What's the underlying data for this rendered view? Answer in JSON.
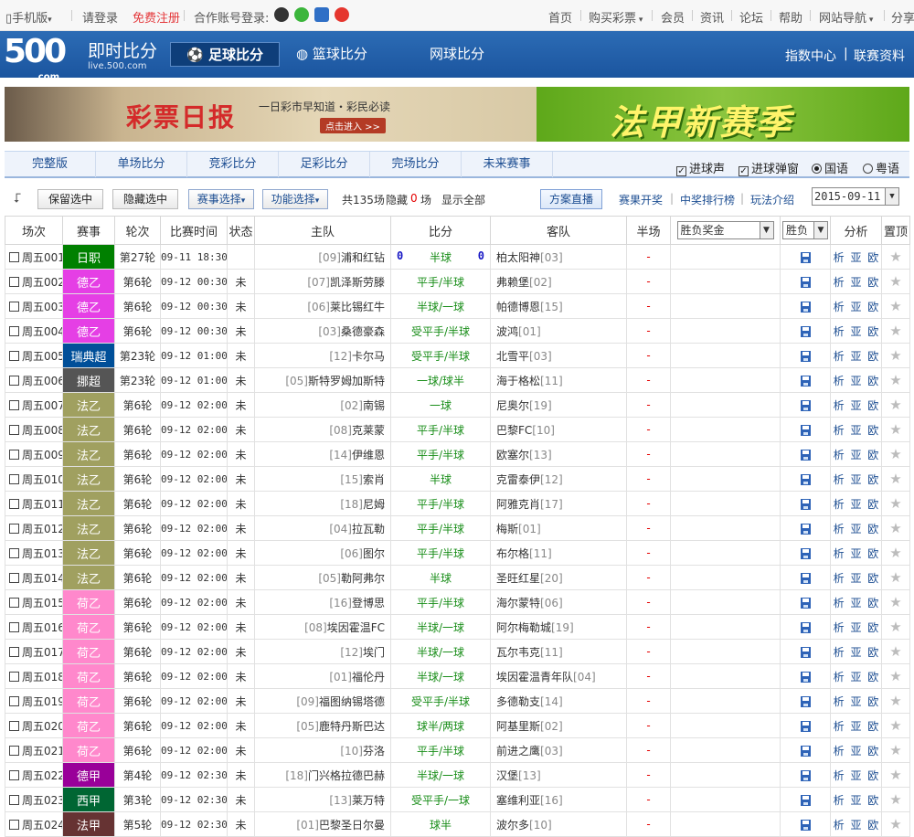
{
  "topbar": {
    "mobile": "手机版",
    "login": "请登录",
    "register": "免费注册",
    "partner_login": "合作账号登录:",
    "nav": [
      "首页",
      "购买彩票",
      "会员",
      "资讯",
      "论坛",
      "帮助",
      "网站导航",
      "分享"
    ]
  },
  "header": {
    "logo": "500",
    "logo_sub": ".com",
    "title": "即时比分",
    "url": "live.500.com",
    "tabs": [
      "足球比分",
      "篮球比分",
      "网球比分"
    ],
    "right_links": [
      "指数中心",
      "联赛资料"
    ],
    "right_sep": "|"
  },
  "banner": {
    "left_title": "彩票日报",
    "left_slogan": "一日彩市早知道・彩民必读",
    "left_button": "点击进入 >>",
    "right_title": "法甲新赛季"
  },
  "category_tabs": [
    "完整版",
    "单场比分",
    "竞彩比分",
    "足彩比分",
    "完场比分",
    "未来赛事"
  ],
  "options": {
    "goal_sound": "进球声",
    "goal_popup": "进球弹窗",
    "mandarin": "国语",
    "cantonese": "粤语"
  },
  "toolbar": {
    "keep_selected": "保留选中",
    "hide_selected": "隐藏选中",
    "event_filter": "赛事选择",
    "function_filter": "功能选择",
    "total_label": "共135场",
    "hidden_label": "隐藏",
    "hidden_count": "0",
    "hidden_unit": "场",
    "show_all": "显示全部",
    "plan_live": "方案直播",
    "result_draw": "赛果开奖",
    "prize_rank": "中奖排行榜",
    "play_intro": "玩法介绍",
    "date": "2015-09-11"
  },
  "table": {
    "headers": [
      "场次",
      "赛事",
      "轮次",
      "比赛时间",
      "状态",
      "主队",
      "比分",
      "客队",
      "半场",
      "胜负奖金",
      "胜负",
      "分析",
      "置顶"
    ],
    "analysis_links": "析 亚 欧",
    "rows": [
      {
        "no": "周五001",
        "league": "日职",
        "color": "#008000",
        "round": "第27轮",
        "time": "09-11 18:30",
        "status": "",
        "home_rank": "[09]",
        "home": "浦和红钻",
        "score": "半球",
        "hs": "0",
        "as": "0",
        "away": "柏太阳神",
        "away_rank": "[03]",
        "half": "-"
      },
      {
        "no": "周五002",
        "league": "德乙",
        "color": "#e53fe5",
        "round": "第6轮",
        "time": "09-12 00:30",
        "status": "未",
        "home_rank": "[07]",
        "home": "凯泽斯劳滕",
        "score": "平手/半球",
        "away": "弗赖堡",
        "away_rank": "[02]",
        "half": "-"
      },
      {
        "no": "周五003",
        "league": "德乙",
        "color": "#e53fe5",
        "round": "第6轮",
        "time": "09-12 00:30",
        "status": "未",
        "home_rank": "[06]",
        "home": "莱比锡红牛",
        "score": "半球/一球",
        "away": "帕德博恩",
        "away_rank": "[15]",
        "half": "-"
      },
      {
        "no": "周五004",
        "league": "德乙",
        "color": "#e53fe5",
        "round": "第6轮",
        "time": "09-12 00:30",
        "status": "未",
        "home_rank": "[03]",
        "home": "桑德豪森",
        "score": "受平手/半球",
        "away": "波鸿",
        "away_rank": "[01]",
        "half": "-"
      },
      {
        "no": "周五005",
        "league": "瑞典超",
        "color": "#004f99",
        "round": "第23轮",
        "time": "09-12 01:00",
        "status": "未",
        "home_rank": "[12]",
        "home": "卡尔马",
        "score": "受平手/半球",
        "away": "北雪平",
        "away_rank": "[03]",
        "half": "-"
      },
      {
        "no": "周五006",
        "league": "挪超",
        "color": "#555555",
        "round": "第23轮",
        "time": "09-12 01:00",
        "status": "未",
        "home_rank": "[05]",
        "home": "斯特罗姆加斯特",
        "score": "一球/球半",
        "away": "海于格松",
        "away_rank": "[11]",
        "half": "-"
      },
      {
        "no": "周五007",
        "league": "法乙",
        "color": "#a0a060",
        "round": "第6轮",
        "time": "09-12 02:00",
        "status": "未",
        "home_rank": "[02]",
        "home": "南锡",
        "score": "一球",
        "away": "尼奥尔",
        "away_rank": "[19]",
        "half": "-"
      },
      {
        "no": "周五008",
        "league": "法乙",
        "color": "#a0a060",
        "round": "第6轮",
        "time": "09-12 02:00",
        "status": "未",
        "home_rank": "[08]",
        "home": "克莱蒙",
        "score": "平手/半球",
        "away": "巴黎FC",
        "away_rank": "[10]",
        "half": "-"
      },
      {
        "no": "周五009",
        "league": "法乙",
        "color": "#a0a060",
        "round": "第6轮",
        "time": "09-12 02:00",
        "status": "未",
        "home_rank": "[14]",
        "home": "伊维恩",
        "score": "平手/半球",
        "away": "欧塞尔",
        "away_rank": "[13]",
        "half": "-"
      },
      {
        "no": "周五010",
        "league": "法乙",
        "color": "#a0a060",
        "round": "第6轮",
        "time": "09-12 02:00",
        "status": "未",
        "home_rank": "[15]",
        "home": "索肖",
        "score": "半球",
        "away": "克雷泰伊",
        "away_rank": "[12]",
        "half": "-"
      },
      {
        "no": "周五011",
        "league": "法乙",
        "color": "#a0a060",
        "round": "第6轮",
        "time": "09-12 02:00",
        "status": "未",
        "home_rank": "[18]",
        "home": "尼姆",
        "score": "平手/半球",
        "away": "阿雅克肖",
        "away_rank": "[17]",
        "half": "-"
      },
      {
        "no": "周五012",
        "league": "法乙",
        "color": "#a0a060",
        "round": "第6轮",
        "time": "09-12 02:00",
        "status": "未",
        "home_rank": "[04]",
        "home": "拉瓦勒",
        "score": "平手/半球",
        "away": "梅斯",
        "away_rank": "[01]",
        "half": "-"
      },
      {
        "no": "周五013",
        "league": "法乙",
        "color": "#a0a060",
        "round": "第6轮",
        "time": "09-12 02:00",
        "status": "未",
        "home_rank": "[06]",
        "home": "图尔",
        "score": "平手/半球",
        "away": "布尔格",
        "away_rank": "[11]",
        "half": "-"
      },
      {
        "no": "周五014",
        "league": "法乙",
        "color": "#a0a060",
        "round": "第6轮",
        "time": "09-12 02:00",
        "status": "未",
        "home_rank": "[05]",
        "home": "勒阿弗尔",
        "score": "半球",
        "away": "圣旺红星",
        "away_rank": "[20]",
        "half": "-"
      },
      {
        "no": "周五015",
        "league": "荷乙",
        "color": "#ff88cc",
        "round": "第6轮",
        "time": "09-12 02:00",
        "status": "未",
        "home_rank": "[16]",
        "home": "登博思",
        "score": "平手/半球",
        "away": "海尔蒙特",
        "away_rank": "[06]",
        "half": "-"
      },
      {
        "no": "周五016",
        "league": "荷乙",
        "color": "#ff88cc",
        "round": "第6轮",
        "time": "09-12 02:00",
        "status": "未",
        "home_rank": "[08]",
        "home": "埃因霍温FC",
        "score": "半球/一球",
        "away": "阿尔梅勒城",
        "away_rank": "[19]",
        "half": "-"
      },
      {
        "no": "周五017",
        "league": "荷乙",
        "color": "#ff88cc",
        "round": "第6轮",
        "time": "09-12 02:00",
        "status": "未",
        "home_rank": "[12]",
        "home": "埃门",
        "score": "半球/一球",
        "away": "瓦尔韦克",
        "away_rank": "[11]",
        "half": "-"
      },
      {
        "no": "周五018",
        "league": "荷乙",
        "color": "#ff88cc",
        "round": "第6轮",
        "time": "09-12 02:00",
        "status": "未",
        "home_rank": "[01]",
        "home": "福伦丹",
        "score": "半球/一球",
        "away": "埃因霍温青年队",
        "away_rank": "[04]",
        "half": "-"
      },
      {
        "no": "周五019",
        "league": "荷乙",
        "color": "#ff88cc",
        "round": "第6轮",
        "time": "09-12 02:00",
        "status": "未",
        "home_rank": "[09]",
        "home": "福图纳锡塔德",
        "score": "受平手/半球",
        "away": "多德勒支",
        "away_rank": "[14]",
        "half": "-"
      },
      {
        "no": "周五020",
        "league": "荷乙",
        "color": "#ff88cc",
        "round": "第6轮",
        "time": "09-12 02:00",
        "status": "未",
        "home_rank": "[05]",
        "home": "鹿特丹斯巴达",
        "score": "球半/两球",
        "away": "阿基里斯",
        "away_rank": "[02]",
        "half": "-"
      },
      {
        "no": "周五021",
        "league": "荷乙",
        "color": "#ff88cc",
        "round": "第6轮",
        "time": "09-12 02:00",
        "status": "未",
        "home_rank": "[10]",
        "home": "芬洛",
        "score": "平手/半球",
        "away": "前进之鹰",
        "away_rank": "[03]",
        "half": "-"
      },
      {
        "no": "周五022",
        "league": "德甲",
        "color": "#990099",
        "round": "第4轮",
        "time": "09-12 02:30",
        "status": "未",
        "home_rank": "[18]",
        "home": "门兴格拉德巴赫",
        "score": "半球/一球",
        "away": "汉堡",
        "away_rank": "[13]",
        "half": "-"
      },
      {
        "no": "周五023",
        "league": "西甲",
        "color": "#006633",
        "round": "第3轮",
        "time": "09-12 02:30",
        "status": "未",
        "home_rank": "[13]",
        "home": "莱万特",
        "score": "受平手/一球",
        "away": "塞维利亚",
        "away_rank": "[16]",
        "half": "-"
      },
      {
        "no": "周五024",
        "league": "法甲",
        "color": "#663333",
        "round": "第5轮",
        "time": "09-12 02:30",
        "status": "未",
        "home_rank": "[01]",
        "home": "巴黎圣日尔曼",
        "score": "球半",
        "away": "波尔多",
        "away_rank": "[10]",
        "half": "-"
      }
    ],
    "prize_select": "胜负奖金",
    "wl_select": "胜负"
  },
  "colors": {
    "accent": "#1d4e92",
    "header_bg": "#1b559f",
    "handicap": "#188d18"
  }
}
